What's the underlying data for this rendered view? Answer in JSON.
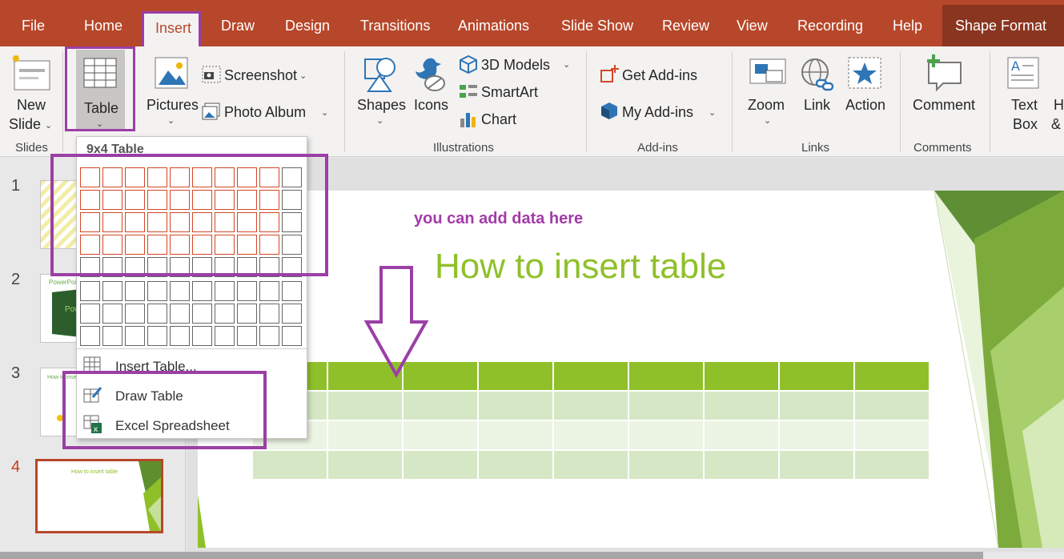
{
  "tabs": [
    "File",
    "Home",
    "Insert",
    "Draw",
    "Design",
    "Transitions",
    "Animations",
    "Slide Show",
    "Review",
    "View",
    "Recording",
    "Help",
    "Shape Format"
  ],
  "ribbon": {
    "slides": {
      "new_slide": "New",
      "new_slide_2": "Slide",
      "group": "Slides"
    },
    "tables": {
      "table": "Table"
    },
    "images": {
      "pictures": "Pictures",
      "screenshot": "Screenshot",
      "photo_album": "Photo Album"
    },
    "illustrations": {
      "shapes": "Shapes",
      "icons": "Icons",
      "models": "3D Models",
      "smartart": "SmartArt",
      "chart": "Chart",
      "group": "Illustrations"
    },
    "addins": {
      "get": "Get Add-ins",
      "my": "My Add-ins",
      "group": "Add-ins"
    },
    "links": {
      "zoom": "Zoom",
      "link": "Link",
      "action": "Action",
      "group": "Links"
    },
    "comments": {
      "comment": "Comment",
      "group": "Comments"
    },
    "text": {
      "textbox": "Text",
      "textbox_2": "Box",
      "extra_1": "H",
      "extra_2": "&"
    }
  },
  "dropdown": {
    "title": "9x4 Table",
    "grid": {
      "cols": 10,
      "rows": 8,
      "selected_cols": 9,
      "selected_rows": 4
    },
    "items": [
      "Insert Table...",
      "Draw Table",
      "Excel Spreadsheet"
    ]
  },
  "slides": {
    "numbers": [
      "1",
      "2",
      "3",
      "4"
    ],
    "thumb2_text": "PowerPoint",
    "thumb2_text_b": "Pow",
    "thumb3_text": "How to inse",
    "thumb4_text": "How to insert table"
  },
  "slide": {
    "annotation": "you can add data here",
    "title": "How to insert table",
    "table": {
      "cols": 9,
      "rows": 4
    }
  },
  "colors": {
    "brand": "#b7472a",
    "highlight": "#9b3fa6",
    "table_header": "#8fc02a",
    "title": "#8fc02a"
  }
}
